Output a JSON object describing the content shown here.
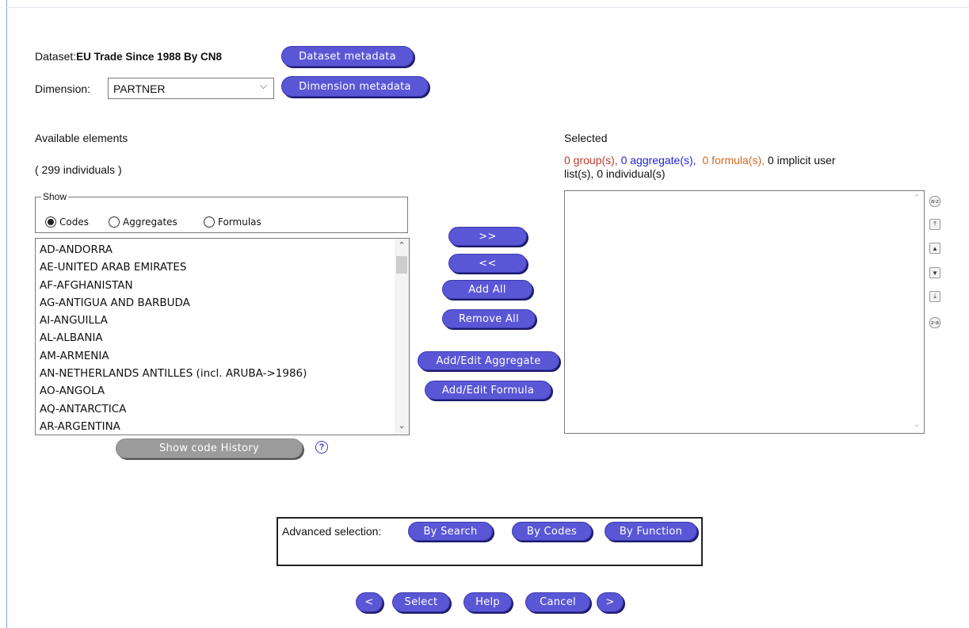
{
  "dataset": {
    "label": "Dataset:",
    "name": "EU Trade Since 1988 By CN8",
    "metadata_button": "Dataset metadata"
  },
  "dimension": {
    "label": "Dimension:",
    "selected": "PARTNER",
    "metadata_button": "Dimension metadata"
  },
  "available": {
    "title": "Available elements",
    "count": "( 299 individuals )",
    "show_legend": "Show",
    "options": [
      "Codes",
      "Aggregates",
      "Formulas"
    ],
    "selected_option": "Codes",
    "items": [
      "AD-ANDORRA",
      "AE-UNITED ARAB EMIRATES",
      "AF-AFGHANISTAN",
      "AG-ANTIGUA AND BARBUDA",
      "AI-ANGUILLA",
      "AL-ALBANIA",
      "AM-ARMENIA",
      "AN-NETHERLANDS ANTILLES (incl. ARUBA->1986)",
      "AO-ANGOLA",
      "AQ-ANTARCTICA",
      "AR-ARGENTINA"
    ],
    "history_button": "Show code History",
    "help_icon": "?"
  },
  "actions": {
    "add": ">>",
    "remove": "<<",
    "add_all": "Add All",
    "remove_all": "Remove All",
    "edit_aggregate": "Add/Edit Aggregate",
    "edit_formula": "Add/Edit Formula"
  },
  "selected": {
    "title": "Selected",
    "groups": "0 group(s),",
    "aggregates": "0 aggregate(s),",
    "formulas": "0 formula(s),",
    "rest_line1": "0 implicit user",
    "rest_line2": "list(s), 0 individual(s)",
    "colors": {
      "groups": "#c0392b",
      "aggregates": "#2323d8",
      "formulas": "#d2691e"
    }
  },
  "sort_icons": [
    "sort-az-icon",
    "move-top-icon",
    "move-up-icon",
    "move-down-icon",
    "move-bottom-icon",
    "sort-za-icon"
  ],
  "sort_labels": {
    "az": "a-z",
    "za": "z-a"
  },
  "advanced": {
    "label": "Advanced selection:",
    "by_search": "By Search",
    "by_codes": "By Codes",
    "by_function": "By Function"
  },
  "nav": {
    "prev": "<",
    "select": "Select",
    "help": "Help",
    "cancel": "Cancel",
    "next": ">"
  }
}
